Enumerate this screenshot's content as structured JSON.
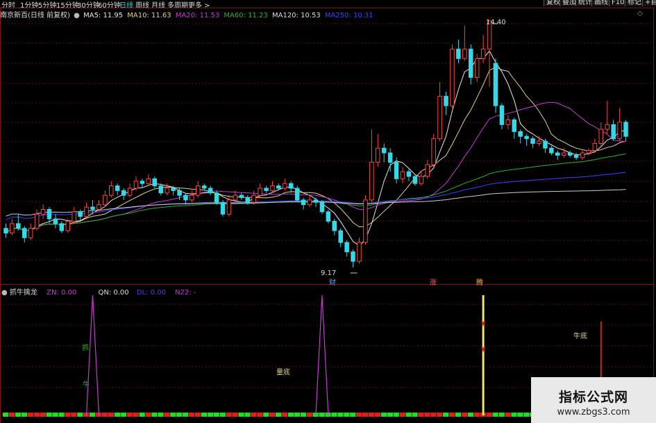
{
  "periods": [
    "分时",
    "1分钟",
    "5分钟",
    "15分钟",
    "30分钟",
    "60分钟",
    "日线",
    "周线",
    "月线",
    "多周期",
    "更多 >"
  ],
  "active_period": "日线",
  "toolbar": [
    "复权",
    "叠加",
    "统计",
    "画线",
    "F10",
    "标记",
    "+自"
  ],
  "diamond_glyph": "◇",
  "main_info": {
    "title": "南京新百(日线 前复权)",
    "ma5": "MA5: 11.95",
    "ma10": "MA10: 11.63",
    "ma20": "MA20: 11.53",
    "ma60": "MA60: 11.23",
    "ma120": "MA120: 10.53",
    "ma250": "MA250: 10.31"
  },
  "annotations": {
    "high": "14.40",
    "low": "9.17",
    "event1": "财",
    "event2": "涨",
    "event3": "腾"
  },
  "sub_info": {
    "name": "抓牛擒龙",
    "zn": "ZN: 0.00",
    "qn": "QN: 0.00",
    "dl": "DL: 0.00",
    "n22": "N22: -"
  },
  "signals": {
    "zhua": "抓",
    "niu": "牛",
    "liangdi": "量底",
    "niudi": "牛底"
  },
  "watermark": {
    "title": "指标公式网",
    "url": "www.zbgs3.com"
  },
  "colors": {
    "up": "#ff4444",
    "down": "#36d8e8",
    "ma5": "#e8e8e8",
    "ma10": "#e0d28c",
    "ma20": "#c03ed0",
    "ma60": "#30b030",
    "ma120": "#4040ff",
    "ma250": "#cccccc",
    "grid": "#5a0f0f"
  },
  "chart_data": {
    "type": "candlestick",
    "price_high": 14.4,
    "price_low": 9.17,
    "candles": [
      [
        10.0,
        9.9,
        10.1,
        9.8
      ],
      [
        9.9,
        10.1,
        10.2,
        9.85
      ],
      [
        10.1,
        10.0,
        10.3,
        9.95
      ],
      [
        10.0,
        9.8,
        10.05,
        9.7
      ],
      [
        9.8,
        10.0,
        10.1,
        9.75
      ],
      [
        10.0,
        10.3,
        10.4,
        9.95
      ],
      [
        10.3,
        10.4,
        10.5,
        10.2
      ],
      [
        10.4,
        10.2,
        10.45,
        10.1
      ],
      [
        10.2,
        10.1,
        10.3,
        10.0
      ],
      [
        10.1,
        9.95,
        10.15,
        9.9
      ],
      [
        9.95,
        10.15,
        10.2,
        9.9
      ],
      [
        10.15,
        10.35,
        10.45,
        10.1
      ],
      [
        10.35,
        10.25,
        10.4,
        10.15
      ],
      [
        10.25,
        10.45,
        10.55,
        10.2
      ],
      [
        10.45,
        10.4,
        10.6,
        10.3
      ],
      [
        10.4,
        10.5,
        10.6,
        10.35
      ],
      [
        10.5,
        10.7,
        10.8,
        10.45
      ],
      [
        10.7,
        10.9,
        11.0,
        10.65
      ],
      [
        10.9,
        10.8,
        10.95,
        10.7
      ],
      [
        10.8,
        10.7,
        10.85,
        10.6
      ],
      [
        10.7,
        10.85,
        10.95,
        10.65
      ],
      [
        10.85,
        11.0,
        11.1,
        10.8
      ],
      [
        11.0,
        10.95,
        11.05,
        10.85
      ],
      [
        10.95,
        11.05,
        11.15,
        10.9
      ],
      [
        11.05,
        10.9,
        11.1,
        10.85
      ],
      [
        10.9,
        10.75,
        10.95,
        10.7
      ],
      [
        10.75,
        10.85,
        10.95,
        10.7
      ],
      [
        10.85,
        10.8,
        10.9,
        10.7
      ],
      [
        10.8,
        10.7,
        10.85,
        10.6
      ],
      [
        10.7,
        10.6,
        10.75,
        10.5
      ],
      [
        10.6,
        10.7,
        10.8,
        10.55
      ],
      [
        10.7,
        10.9,
        11.0,
        10.65
      ],
      [
        10.9,
        10.85,
        10.95,
        10.8
      ],
      [
        10.85,
        10.75,
        10.9,
        10.7
      ],
      [
        10.75,
        10.55,
        10.8,
        10.5
      ],
      [
        10.55,
        10.3,
        10.6,
        10.25
      ],
      [
        10.3,
        10.6,
        10.7,
        10.25
      ],
      [
        10.6,
        10.7,
        10.8,
        10.55
      ],
      [
        10.7,
        10.65,
        10.75,
        10.6
      ],
      [
        10.65,
        10.55,
        10.7,
        10.5
      ],
      [
        10.55,
        10.7,
        10.8,
        10.5
      ],
      [
        10.7,
        10.85,
        10.95,
        10.65
      ],
      [
        10.85,
        10.8,
        10.9,
        10.75
      ],
      [
        10.8,
        10.9,
        11.0,
        10.75
      ],
      [
        10.9,
        10.85,
        10.95,
        10.8
      ],
      [
        10.85,
        10.95,
        11.05,
        10.8
      ],
      [
        10.95,
        10.85,
        11.0,
        10.75
      ],
      [
        10.85,
        10.6,
        10.9,
        10.55
      ],
      [
        10.6,
        10.5,
        10.65,
        10.4
      ],
      [
        10.5,
        10.6,
        10.7,
        10.45
      ],
      [
        10.6,
        10.55,
        10.65,
        10.45
      ],
      [
        10.55,
        10.35,
        10.6,
        10.3
      ],
      [
        10.35,
        10.15,
        10.4,
        10.1
      ],
      [
        10.15,
        9.95,
        10.2,
        9.85
      ],
      [
        9.95,
        9.7,
        10.0,
        9.6
      ],
      [
        9.7,
        9.5,
        9.75,
        9.4
      ],
      [
        9.5,
        9.3,
        9.55,
        9.17
      ],
      [
        9.3,
        9.7,
        9.8,
        9.25
      ],
      [
        9.7,
        10.6,
        10.7,
        9.65
      ],
      [
        10.6,
        11.4,
        12.1,
        10.55
      ],
      [
        11.4,
        11.7,
        12.0,
        11.3
      ],
      [
        11.7,
        11.6,
        11.8,
        11.4
      ],
      [
        11.6,
        11.4,
        11.7,
        11.2
      ],
      [
        11.4,
        11.05,
        11.5,
        10.95
      ],
      [
        11.05,
        11.2,
        11.3,
        10.95
      ],
      [
        11.2,
        11.1,
        11.25,
        11.0
      ],
      [
        11.1,
        10.95,
        11.15,
        10.9
      ],
      [
        10.95,
        11.1,
        11.2,
        10.9
      ],
      [
        11.1,
        11.35,
        11.45,
        11.05
      ],
      [
        11.35,
        11.9,
        12.0,
        11.3
      ],
      [
        11.9,
        12.8,
        13.1,
        11.85
      ],
      [
        12.8,
        12.6,
        12.9,
        12.4
      ],
      [
        12.6,
        13.8,
        13.9,
        12.55
      ],
      [
        13.8,
        13.6,
        14.0,
        13.5
      ],
      [
        13.6,
        13.8,
        14.3,
        13.55
      ],
      [
        13.8,
        13.2,
        13.9,
        13.05
      ],
      [
        13.2,
        13.6,
        13.7,
        13.1
      ],
      [
        13.6,
        13.8,
        14.1,
        13.5
      ],
      [
        13.8,
        14.4,
        14.4,
        13.0
      ],
      [
        13.5,
        12.6,
        13.6,
        12.45
      ],
      [
        12.6,
        12.2,
        12.65,
        12.1
      ],
      [
        12.2,
        12.3,
        12.4,
        12.1
      ],
      [
        12.3,
        12.05,
        12.35,
        11.9
      ],
      [
        12.05,
        11.95,
        12.1,
        11.8
      ],
      [
        11.95,
        11.9,
        12.0,
        11.75
      ],
      [
        11.9,
        11.8,
        11.95,
        11.7
      ],
      [
        11.8,
        11.85,
        11.95,
        11.75
      ],
      [
        11.85,
        11.7,
        11.9,
        11.6
      ],
      [
        11.7,
        11.6,
        11.75,
        11.55
      ],
      [
        11.6,
        11.55,
        11.65,
        11.45
      ],
      [
        11.55,
        11.6,
        11.7,
        11.5
      ],
      [
        11.6,
        11.55,
        11.65,
        11.5
      ],
      [
        11.55,
        11.5,
        11.6,
        11.45
      ],
      [
        11.5,
        11.6,
        11.65,
        11.45
      ],
      [
        11.6,
        11.65,
        11.7,
        11.55
      ],
      [
        11.65,
        11.8,
        11.9,
        11.6
      ],
      [
        11.8,
        12.1,
        12.25,
        11.75
      ],
      [
        12.1,
        12.2,
        12.7,
        12.0
      ],
      [
        12.2,
        11.9,
        12.3,
        11.85
      ],
      [
        11.9,
        12.25,
        12.55,
        11.85
      ],
      [
        12.25,
        11.95,
        12.3,
        11.85
      ]
    ],
    "pulses": [
      {
        "bar": 14,
        "height": 1.0,
        "color": "#c03ed0"
      },
      {
        "bar": 51,
        "height": 1.0,
        "color": "#c03ed0"
      }
    ],
    "signal_lines": [
      {
        "bar": 77,
        "height": 1.0,
        "color": "#f2ea5a"
      },
      {
        "bar": 96,
        "height": 0.78,
        "color": "#cc2222"
      }
    ]
  }
}
